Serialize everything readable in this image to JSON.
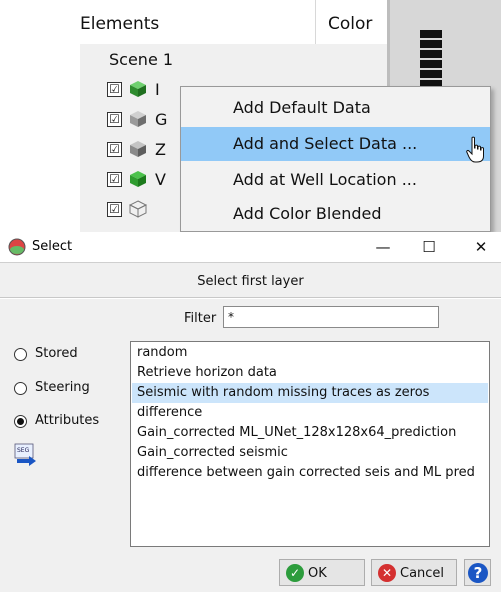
{
  "tree": {
    "col_elements": "Elements",
    "col_color": "Color",
    "scene_label": "Scene 1",
    "rows": [
      {
        "checked": "☑",
        "icon": "green-cube-icon",
        "color": "#3da83d",
        "text": "I"
      },
      {
        "checked": "☑",
        "icon": "gray-cube-icon",
        "color": "#9a9a9a",
        "text": "G"
      },
      {
        "checked": "☑",
        "icon": "gray-cube-icon",
        "color": "#8a8a8a",
        "text": "Z"
      },
      {
        "checked": "☑",
        "icon": "green-cube-icon",
        "color": "#2f9c2f",
        "text": "V"
      },
      {
        "checked": "☑",
        "icon": "wireframe-cube-icon",
        "color": "#777777",
        "text": ""
      }
    ]
  },
  "context_menu": {
    "items": [
      {
        "label": "Add Default Data"
      },
      {
        "label": "Add and Select Data ..."
      },
      {
        "label": "Add at Well Location ..."
      },
      {
        "label": "Add Color Blended"
      }
    ],
    "highlight_color": "#91c9f7"
  },
  "dialog": {
    "title": "Select",
    "minimize": "—",
    "maximize": "☐",
    "close": "✕",
    "select_title": "Select  first layer",
    "filter_label": "Filter",
    "filter_value": "*",
    "radios": [
      {
        "label": "Stored",
        "checked": false
      },
      {
        "label": "Steering",
        "checked": false
      },
      {
        "label": "Attributes",
        "checked": true
      }
    ],
    "list_items": [
      "random",
      "Retrieve horizon data",
      "Seismic with random missing traces as zeros",
      "difference",
      "Gain_corrected ML_UNet_128x128x64_prediction",
      "Gain_corrected seismic",
      "difference between gain corrected seis and ML pred"
    ],
    "selected_item": "Seismic with random missing traces as zeros",
    "selection_color": "#cce5fb",
    "ok_label": "OK",
    "cancel_label": "Cancel",
    "help_label": "?"
  }
}
